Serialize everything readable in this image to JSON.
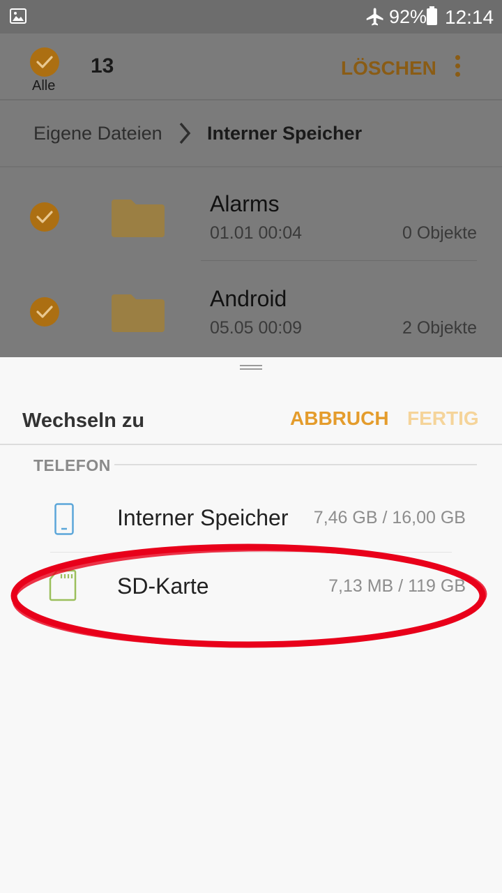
{
  "status_bar": {
    "battery_percent": "92%",
    "time": "12:14",
    "icons": [
      "image-icon",
      "airplane-icon",
      "battery-icon"
    ]
  },
  "selection_toolbar": {
    "select_all_label": "Alle",
    "selected_count": "13",
    "delete_label": "LÖSCHEN",
    "accent_color": "#ac6f12"
  },
  "breadcrumb": {
    "root": "Eigene Dateien",
    "current": "Interner Speicher"
  },
  "files": [
    {
      "name": "Alarms",
      "date": "01.01 00:04",
      "count": "0 Objekte",
      "checked": true
    },
    {
      "name": "Android",
      "date": "05.05 00:09",
      "count": "2 Objekte",
      "checked": true
    }
  ],
  "sheet": {
    "title": "Wechseln zu",
    "cancel_label": "ABBRUCH",
    "done_label": "FERTIG",
    "section_label": "TELEFON",
    "storages": [
      {
        "name": "Interner Speicher",
        "size": "7,46 GB / 16,00 GB",
        "icon": "phone-storage-icon",
        "icon_color": "#5ba6d9"
      },
      {
        "name": "SD-Karte",
        "size": "7,13 MB / 119 GB",
        "icon": "sd-card-icon",
        "icon_color": "#9bbf5c"
      }
    ],
    "cancel_color": "#e49c2c",
    "done_color": "#f5d49a"
  },
  "annotation": {
    "color": "#e8001a"
  }
}
